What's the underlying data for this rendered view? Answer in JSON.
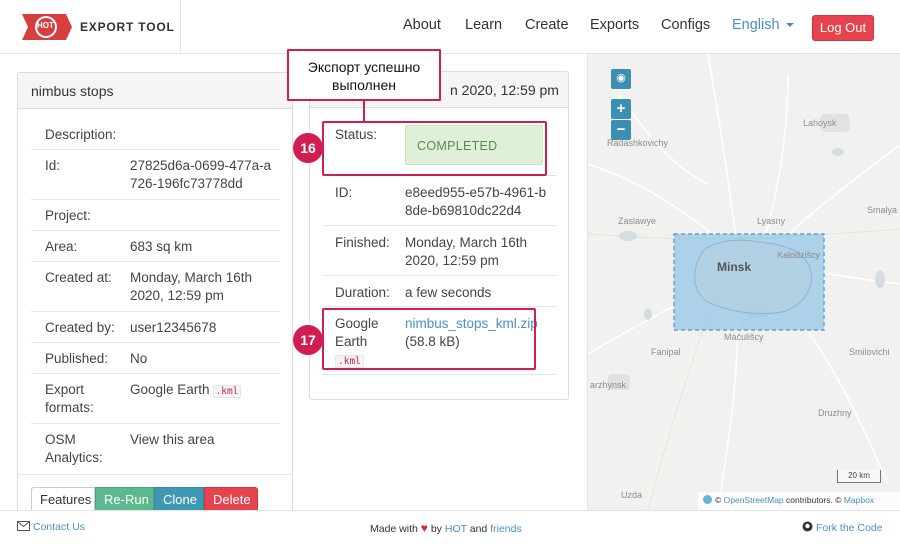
{
  "navbar": {
    "logo_text": "HOT",
    "brand": "EXPORT TOOL",
    "links": {
      "about": "About",
      "learn": "Learn",
      "create": "Create",
      "exports": "Exports",
      "configs": "Configs"
    },
    "language": "English",
    "logout": "Log Out"
  },
  "export_details": {
    "title": "nimbus stops",
    "rows": {
      "description": {
        "label": "Description:",
        "value": ""
      },
      "id": {
        "label": "Id:",
        "value": "27825d6a-0699-477a-a726-196fc73778dd"
      },
      "project": {
        "label": "Project:",
        "value": ""
      },
      "area": {
        "label": "Area:",
        "value": "683 sq km"
      },
      "created_at": {
        "label": "Created at:",
        "value": "Monday, March 16th 2020, 12:59 pm"
      },
      "created_by": {
        "label": "Created by:",
        "value": "user12345678"
      },
      "published": {
        "label": "Published:",
        "value": "No"
      },
      "export_formats": {
        "label": "Export formats:",
        "value": "Google Earth",
        "ext": ".kml"
      },
      "osm_analytics": {
        "label": "OSM Analytics:",
        "value": "View this area"
      }
    },
    "buttons": {
      "features": "Features",
      "rerun": "Re-Run",
      "clone": "Clone",
      "delete": "Delete"
    }
  },
  "run_details": {
    "header": "n 2020, 12:59 pm",
    "status": {
      "label": "Status:",
      "value": "COMPLETED"
    },
    "id": {
      "label": "ID:",
      "value": "e8eed955-e57b-4961-b8de-b69810dc22d4"
    },
    "finished": {
      "label": "Finished:",
      "value": "Monday, March 16th 2020, 12:59 pm"
    },
    "duration": {
      "label": "Duration:",
      "value": "a few seconds"
    },
    "file": {
      "label": "Google Earth",
      "ext": ".kml",
      "link": "nimbus_stops_kml.zip",
      "size": "(58.8 kB)"
    }
  },
  "annotations": {
    "callout_line1": "Экспорт успешно",
    "callout_line2": "выполнен",
    "badge_status": "16",
    "badge_file": "17"
  },
  "map": {
    "zoom_in": "+",
    "zoom_out": "−",
    "labels": {
      "lahoysk": "Lahoysk",
      "radashkovichy": "Radashkovichy",
      "zaslawye": "Zaslawye",
      "lyasny": "Lyasny",
      "smalya": "Smalya",
      "kalodzishchy": "Kalodzišcy",
      "minsk": "Minsk",
      "fanipal": "Fanipal",
      "machulishchy": "Mačulišcy",
      "smilovichi": "Smilovichi",
      "dzyarzhynsk": "arzhynsk",
      "druzhny": "Druzhny",
      "uzda": "Uzda"
    },
    "scale": "20 km",
    "attribution": {
      "copyright": "©",
      "osm": "OpenStreetMap",
      "contributors": "contributors. ©",
      "mapbox": "Mapbox"
    }
  },
  "footer": {
    "contact": "Contact Us",
    "made_with": "Made with",
    "by": "by",
    "hot": "HOT",
    "and": "and",
    "friends": "friends",
    "fork": "Fork the Code"
  },
  "colors": {
    "accent": "#4a90c2",
    "danger": "#e5444f",
    "success": "#5cb88f",
    "info": "#3f98b2",
    "callout": "#d01e52"
  }
}
